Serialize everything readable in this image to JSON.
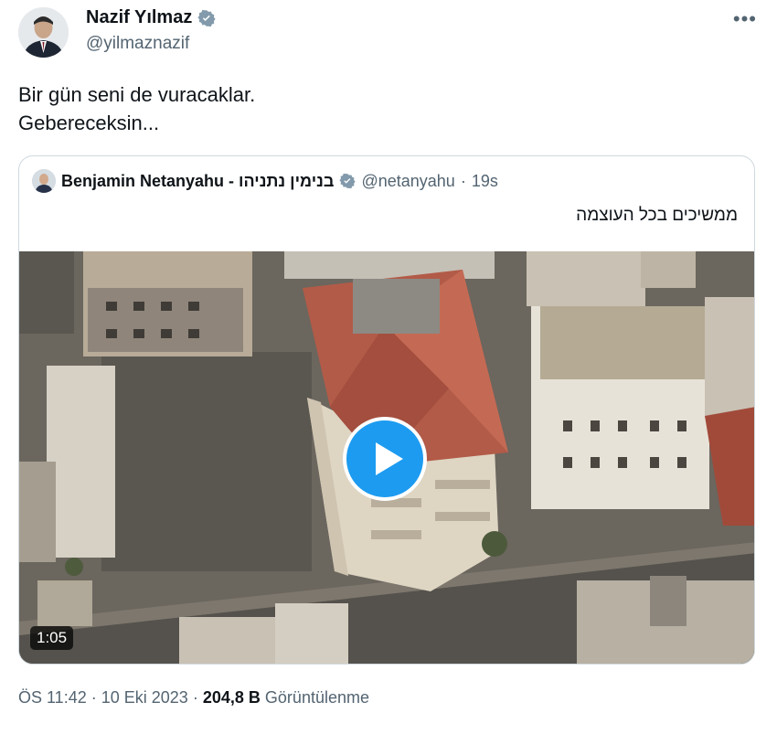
{
  "author": {
    "name": "Nazif Yılmaz",
    "handle": "@yilmaznazif"
  },
  "more_icon": "more-icon",
  "tweet": {
    "lines": [
      "Bir gün seni de vuracaklar.",
      "Gebereceksin..."
    ]
  },
  "quote": {
    "name": "Benjamin Netanyahu - בנימין נתניהו",
    "handle": "@netanyahu",
    "separator": "·",
    "time": "19s",
    "text": "ממשיכים בכל העוצמה",
    "duration": "1:05"
  },
  "meta": {
    "time": "ÖS 11:42",
    "sep1": "·",
    "date": "10 Eki 2023",
    "sep2": "·",
    "views": "204,8 B",
    "views_label": "Görüntülenme"
  },
  "colors": {
    "verified": "#829aab",
    "play": "#1d9bf0",
    "secondary_text": "#536471"
  }
}
